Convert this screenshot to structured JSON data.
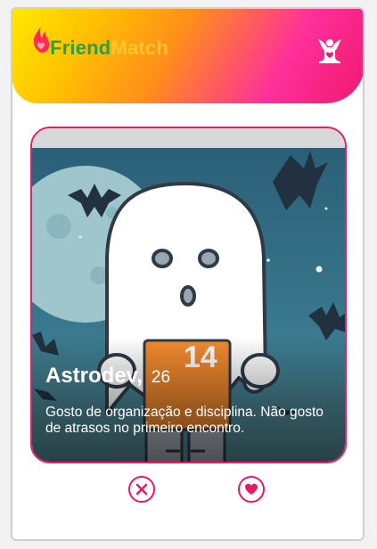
{
  "app": {
    "brand_part1": "Friend",
    "brand_part2": "Match",
    "colors": {
      "accent": "#ea1b6b",
      "brand_green": "#2e9e3e",
      "brand_yellow": "#ffd23a"
    }
  },
  "header": {
    "menu_icon": "jester-menu-icon"
  },
  "profile": {
    "name": "Astrodev,",
    "age": "26",
    "bio": "Gosto de organização e disciplina. Não gosto de atrasos no primeiro encontro.",
    "image_icon": "ghost-halloween-illustration",
    "shirt_number": "14"
  },
  "actions": {
    "dislike_icon": "close-icon",
    "like_icon": "heart-icon"
  }
}
